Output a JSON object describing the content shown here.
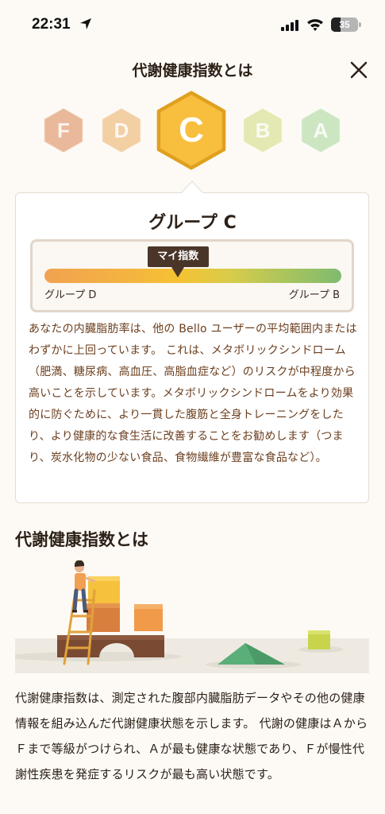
{
  "status_bar": {
    "time": "22:31",
    "battery": "35",
    "battery_level_percent": 35
  },
  "header": {
    "title": "代謝健康指数とは",
    "close_icon": "close-icon"
  },
  "grades": [
    {
      "letter": "F",
      "color": "#eab89a",
      "selected": false
    },
    {
      "letter": "D",
      "color": "#f3cfa4",
      "selected": false
    },
    {
      "letter": "C",
      "color": "#f8be3e",
      "selected": true
    },
    {
      "letter": "B",
      "color": "#e4e8b2",
      "selected": false
    },
    {
      "letter": "A",
      "color": "#cde6c2",
      "selected": false
    }
  ],
  "card": {
    "title": "グループ C",
    "my_index_label": "マイ指数",
    "gauge_left_label": "グループ D",
    "gauge_right_label": "グループ B",
    "gauge_marker_fraction": 0.45,
    "description": "あなたの内臓脂肪率は、他の Bello ユーザーの平均範囲内またはわずかに上回っています。 これは、メタボリックシンドローム（肥満、糖尿病、高血圧、高脂血症など）のリスクが中程度から高いことを示しています。メタボリックシンドロームをより効果的に防ぐために、より一貫した腹筋と全身トレーニングをしたり、より健康的な食生活に改善することをお勧めします（つまり、炭水化物の少ない食品、食物繊維が豊富な食品など）。"
  },
  "section": {
    "title": "代謝健康指数とは",
    "description": "代謝健康指数は、測定された腹部内臓脂肪データやその他の健康情報を組み込んだ代謝健康状態を示します。 代謝の健康はＡからＦまで等級がつけられ、Ａが最も健康な状態であり、Ｆが慢性代謝性疾患を発症するリスクが最も高い状態です。"
  }
}
